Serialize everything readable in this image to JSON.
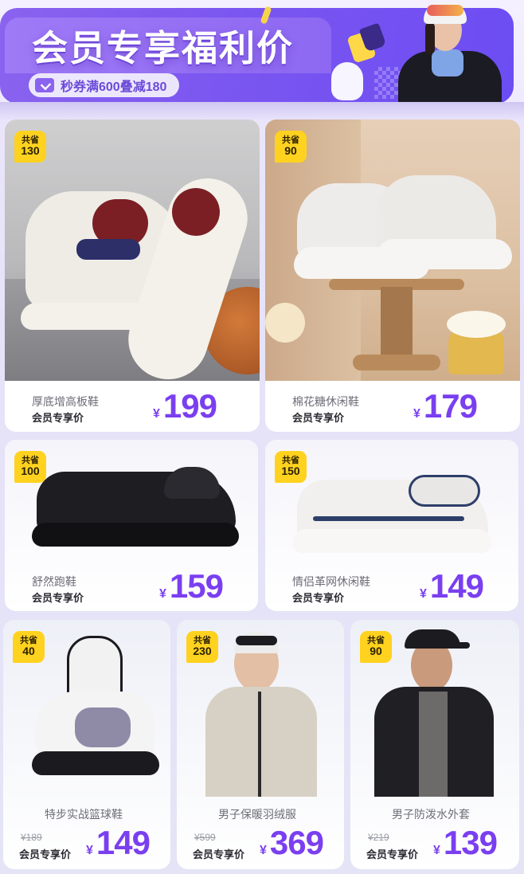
{
  "banner": {
    "title": "会员专享福利价",
    "coupon_text": "秒券满600叠减180"
  },
  "currency": "¥",
  "products": [
    {
      "name": "厚底增高板鞋",
      "member_label": "会员专享价",
      "save_label": "共省",
      "save_amount": "130",
      "price": "199",
      "original_price": ""
    },
    {
      "name": "棉花糖休闲鞋",
      "member_label": "会员专享价",
      "save_label": "共省",
      "save_amount": "90",
      "price": "179",
      "original_price": ""
    },
    {
      "name": "舒然跑鞋",
      "member_label": "会员专享价",
      "save_label": "共省",
      "save_amount": "100",
      "price": "159",
      "original_price": ""
    },
    {
      "name": "情侣革网休闲鞋",
      "member_label": "会员专享价",
      "save_label": "共省",
      "save_amount": "150",
      "price": "149",
      "original_price": ""
    },
    {
      "name": "特步实战篮球鞋",
      "member_label": "会员专享价",
      "save_label": "共省",
      "save_amount": "40",
      "price": "149",
      "original_price": "¥189"
    },
    {
      "name": "男子保暖羽绒服",
      "member_label": "会员专享价",
      "save_label": "共省",
      "save_amount": "230",
      "price": "369",
      "original_price": "¥599"
    },
    {
      "name": "男子防泼水外套",
      "member_label": "会员专享价",
      "save_label": "共省",
      "save_amount": "90",
      "price": "139",
      "original_price": "¥219"
    }
  ],
  "colors": {
    "accent": "#7a3ff0",
    "badge": "#ffd21f",
    "banner": "#7b56f0"
  }
}
